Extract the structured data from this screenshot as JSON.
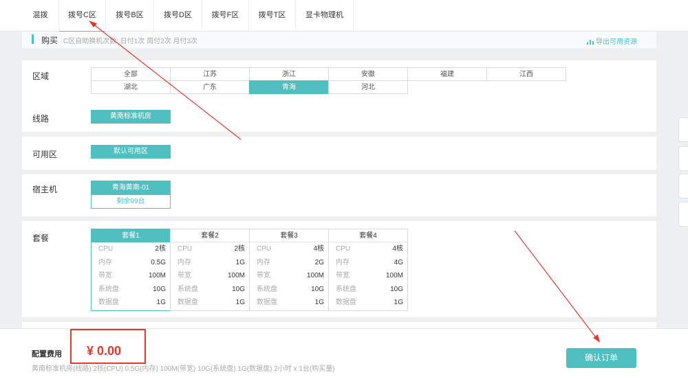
{
  "tabs": [
    {
      "label": "混拨",
      "active": false
    },
    {
      "label": "拨号C区",
      "active": true
    },
    {
      "label": "拨号B区",
      "active": false
    },
    {
      "label": "拨号D区",
      "active": false
    },
    {
      "label": "拨号F区",
      "active": false
    },
    {
      "label": "拨号T区",
      "active": false
    },
    {
      "label": "显卡物理机",
      "active": false
    }
  ],
  "buy": {
    "title": "购买",
    "subtitle": "C区自助换机次数: 日付1次 周付2次 月付3次",
    "export_label": "导出可用资源"
  },
  "region": {
    "label": "区域",
    "options": [
      "全部",
      "江苏",
      "浙江",
      "安徽",
      "福建",
      "江西",
      "湖北",
      "广东",
      "青海",
      "河北"
    ],
    "selected": "青海"
  },
  "line": {
    "label": "线路",
    "value": "黄南标准机房"
  },
  "zone": {
    "label": "可用区",
    "value": "默认可用区"
  },
  "host": {
    "label": "宿主机",
    "name": "青海黄南-01",
    "remaining": "剩余99台"
  },
  "packages": {
    "label": "套餐",
    "selected": "套餐1",
    "items": [
      {
        "name": "套餐1",
        "rows": [
          [
            "CPU",
            "2核"
          ],
          [
            "内存",
            "0.5G"
          ],
          [
            "带宽",
            "100M"
          ],
          [
            "系统盘",
            "10G"
          ],
          [
            "数据盘",
            "1G"
          ]
        ]
      },
      {
        "name": "套餐2",
        "rows": [
          [
            "CPU",
            "2核"
          ],
          [
            "内存",
            "1G"
          ],
          [
            "带宽",
            "100M"
          ],
          [
            "系统盘",
            "10G"
          ],
          [
            "数据盘",
            "1G"
          ]
        ]
      },
      {
        "name": "套餐3",
        "rows": [
          [
            "CPU",
            "4核"
          ],
          [
            "内存",
            "2G"
          ],
          [
            "带宽",
            "100M"
          ],
          [
            "系统盘",
            "10G"
          ],
          [
            "数据盘",
            "1G"
          ]
        ]
      },
      {
        "name": "套餐4",
        "rows": [
          [
            "CPU",
            "4核"
          ],
          [
            "内存",
            "4G"
          ],
          [
            "带宽",
            "100M"
          ],
          [
            "系统盘",
            "10G"
          ],
          [
            "数据盘",
            "1G"
          ]
        ]
      }
    ]
  },
  "footer": {
    "fee_label": "配置费用",
    "price": "¥ 0.00",
    "description": "黄南标准机房(线路) 2核(CPU) 0.5G(内存) 100M(带宽) 10G(系统盘) 1G(数据盘) 2小时 x 1台(购买量)",
    "confirm_label": "确认订单"
  },
  "colors": {
    "accent": "#4fbfbf",
    "annotation": "#e8372a"
  }
}
